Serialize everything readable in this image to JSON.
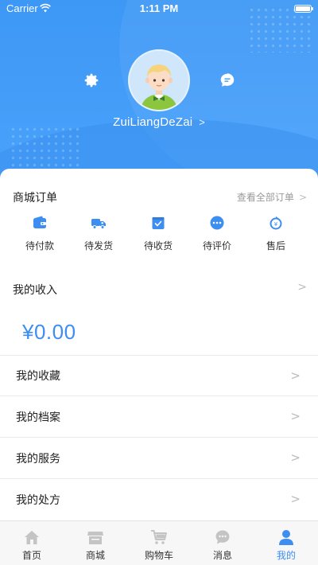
{
  "status_bar": {
    "carrier": "Carrier",
    "time": "1:11 PM"
  },
  "profile": {
    "username": "ZuiLiangDeZai"
  },
  "orders": {
    "title": "商城订单",
    "view_all": "查看全部订单",
    "items": [
      {
        "label": "待付款",
        "icon": "wallet-icon"
      },
      {
        "label": "待发货",
        "icon": "truck-icon"
      },
      {
        "label": "待收货",
        "icon": "receive-box-icon"
      },
      {
        "label": "待评价",
        "icon": "comment-icon"
      },
      {
        "label": "售后",
        "icon": "after-sale-icon"
      }
    ]
  },
  "income": {
    "title": "我的收入",
    "amount": "¥0.00"
  },
  "menu": [
    {
      "label": "我的收藏"
    },
    {
      "label": "我的档案"
    },
    {
      "label": "我的服务"
    },
    {
      "label": "我的处方"
    }
  ],
  "tabs": [
    {
      "label": "首页",
      "icon": "home-icon"
    },
    {
      "label": "商城",
      "icon": "store-icon"
    },
    {
      "label": "购物车",
      "icon": "cart-icon"
    },
    {
      "label": "消息",
      "icon": "message-icon"
    },
    {
      "label": "我的",
      "icon": "profile-icon",
      "active": true
    }
  ],
  "colors": {
    "primary": "#3d8ef0",
    "header": "#4aa3fb",
    "tab_inactive": "#c4c4c4"
  }
}
